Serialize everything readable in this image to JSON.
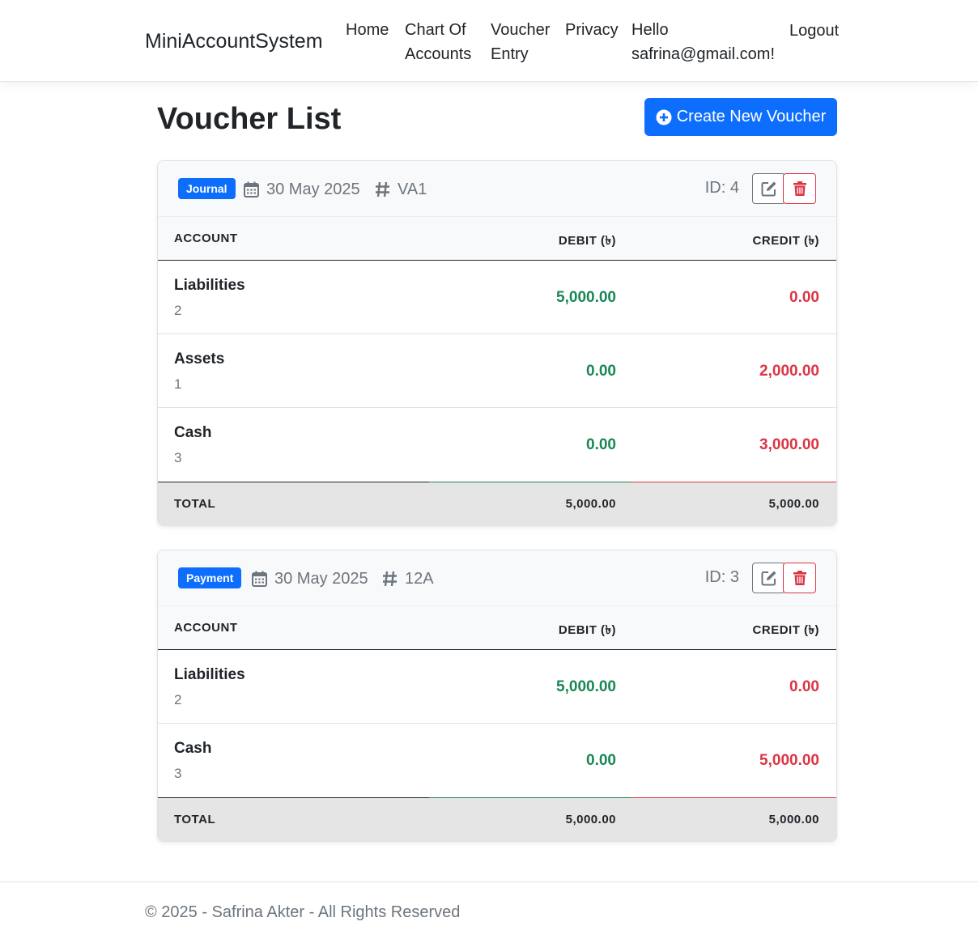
{
  "nav": {
    "brand": "MiniAccountSystem",
    "home": "Home",
    "chart_of_accounts_1": "Chart Of",
    "chart_of_accounts_2": "Accounts",
    "voucher_entry_1": "Voucher",
    "voucher_entry_2": "Entry",
    "privacy": "Privacy",
    "hello_1": "Hello",
    "hello_2": "safrina@gmail.com!",
    "logout": "Logout"
  },
  "page": {
    "title": "Voucher List",
    "create_button": "Create New Voucher"
  },
  "table_headers": {
    "account": "ACCOUNT",
    "debit": "DEBIT (৳)",
    "credit": "CREDIT (৳)",
    "total": "TOTAL"
  },
  "vouchers": [
    {
      "type": "Journal",
      "date": "30 May 2025",
      "reference": "VA1",
      "id_label": "ID: 4",
      "rows": [
        {
          "account": "Liabilities",
          "code": "2",
          "debit": "5,000.00",
          "credit": "0.00"
        },
        {
          "account": "Assets",
          "code": "1",
          "debit": "0.00",
          "credit": "2,000.00"
        },
        {
          "account": "Cash",
          "code": "3",
          "debit": "0.00",
          "credit": "3,000.00"
        }
      ],
      "total_debit": "5,000.00",
      "total_credit": "5,000.00"
    },
    {
      "type": "Payment",
      "date": "30 May 2025",
      "reference": "12A",
      "id_label": "ID: 3",
      "rows": [
        {
          "account": "Liabilities",
          "code": "2",
          "debit": "5,000.00",
          "credit": "0.00"
        },
        {
          "account": "Cash",
          "code": "3",
          "debit": "0.00",
          "credit": "5,000.00"
        }
      ],
      "total_debit": "5,000.00",
      "total_credit": "5,000.00"
    }
  ],
  "footer": {
    "text": "© 2025 - Safrina Akter - All Rights Reserved"
  },
  "colors": {
    "primary": "#0d6efd",
    "debit": "#198754",
    "credit": "#dc3545",
    "muted": "#6c757d"
  },
  "icons": {
    "create": "plus-circle-icon",
    "date": "calendar-icon",
    "reference": "hash-icon",
    "edit": "edit-icon",
    "delete": "trash-icon"
  }
}
